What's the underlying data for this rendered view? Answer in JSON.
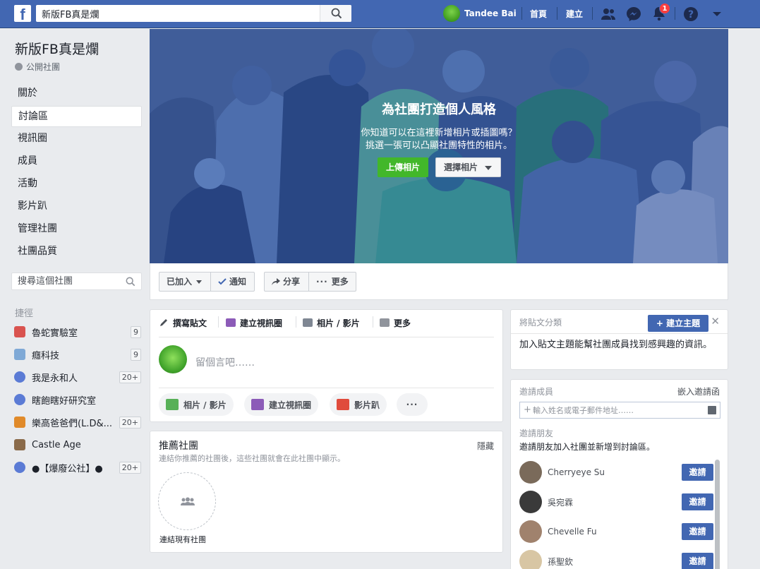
{
  "topbar": {
    "logo": "f",
    "search_value": "新版FB真是爛",
    "user_name": "Tandee Bai",
    "links": [
      "首頁",
      "建立"
    ],
    "notification_count": "1",
    "icons": [
      "friends-icon",
      "messenger-icon",
      "notifications-icon",
      "help-icon",
      "account-menu-icon"
    ]
  },
  "group": {
    "name": "新版FB真是爛",
    "privacy": "公開社團"
  },
  "nav": [
    "關於",
    "討論區",
    "視訊圈",
    "成員",
    "活動",
    "影片趴",
    "管理社團",
    "社團品質"
  ],
  "group_search_placeholder": "搜尋這個社團",
  "shortcuts": {
    "heading": "捷徑",
    "items": [
      {
        "name": "魯蛇實驗室",
        "count": "9",
        "color": "#d9534f"
      },
      {
        "name": "癮科技",
        "count": "9",
        "color": "#7fa9d6"
      },
      {
        "name": "我是永和人",
        "count": "20+",
        "color": "#5b7bd5"
      },
      {
        "name": "瞎飽瞎好研究室",
        "count": "",
        "color": "#5b7bd5"
      },
      {
        "name": "樂高爸爸們(L.D&...",
        "count": "20+",
        "color": "#e08a2a"
      },
      {
        "name": "Castle Age",
        "count": "",
        "color": "#8a6a4a"
      },
      {
        "name": "●【爆廢公社】●",
        "count": "20+",
        "color": "#5b7bd5"
      }
    ]
  },
  "cover": {
    "title": "為社團打造個人風格",
    "line1": "你知道可以在這裡新增相片或插圖嗎？",
    "line2": "挑選一張可以凸顯社團特性的相片。",
    "upload_label": "上傳相片",
    "choose_label": "選擇相片"
  },
  "actions": {
    "joined": "已加入",
    "notify": "通知",
    "share": "分享",
    "more": "更多"
  },
  "composer": {
    "tabs": [
      "撰寫貼文",
      "建立視訊圈",
      "相片 / 影片",
      "更多"
    ],
    "placeholder": "留個言吧……",
    "pills": [
      "相片 / 影片",
      "建立視訊圈",
      "影片趴"
    ]
  },
  "suggest": {
    "title": "推薦社團",
    "hide": "隱藏",
    "subtitle": "連結你推薦的社團後，這些社團就會在此社團中顯示。",
    "link_label": "連結現有社團"
  },
  "topics": {
    "heading": "將貼文分類",
    "create_label": "建立主題",
    "body": "加入貼文主題能幫社團成員找到感興趣的資訊。"
  },
  "invite": {
    "heading": "邀請成員",
    "embed": "嵌入邀請函",
    "input_placeholder": "輸入姓名或電子郵件地址……",
    "friends_heading": "邀請朋友",
    "friends_sub": "邀請朋友加入社團並新增到討論區。",
    "invite_label": "邀請",
    "friends": [
      {
        "name": "Cherryeye Su",
        "color": "#7a6a5a"
      },
      {
        "name": "吳宛霖",
        "color": "#3a3a3a"
      },
      {
        "name": "Chevelle Fu",
        "color": "#a0826d"
      },
      {
        "name": "孫聖欽",
        "color": "#d8c6a4"
      }
    ]
  }
}
